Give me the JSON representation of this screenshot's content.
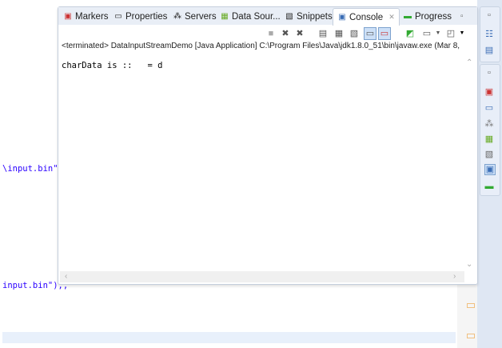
{
  "editor": {
    "line1": "\\input.bin\"",
    "line2": "input.bin\"),;"
  },
  "console": {
    "tabs": [
      {
        "label": "Markers",
        "icon": "markers-icon"
      },
      {
        "label": "Properties",
        "icon": "properties-icon"
      },
      {
        "label": "Servers",
        "icon": "servers-icon"
      },
      {
        "label": "Data Sour...",
        "icon": "data-source-icon"
      },
      {
        "label": "Snippets",
        "icon": "snippets-icon"
      },
      {
        "label": "Console",
        "icon": "console-icon"
      },
      {
        "label": "Progress",
        "icon": "progress-icon"
      }
    ],
    "close_glyph": "✕",
    "terminated": "<terminated> DataInputStreamDemo [Java Application] C:\\Program Files\\Java\\jdk1.8.0_51\\bin\\javaw.exe (Mar 8,",
    "output": "charData is ::   = d"
  },
  "colors": {
    "accent": "#2a00ff",
    "trim": "#dfe7f3"
  }
}
